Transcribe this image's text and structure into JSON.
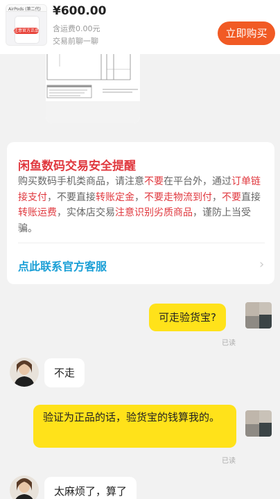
{
  "product": {
    "price": "¥600.00",
    "shipping": "含运费0.00元",
    "negotiate": "交易前聊一聊",
    "buy_label": "立即购买",
    "thumb_topbar": "AirPods (第二代)",
    "thumb_tag": "注意官方正品"
  },
  "notice": {
    "title": "闲鱼数码交易安全提醒",
    "body_parts": [
      {
        "text": "购买数码手机类商品，请注意",
        "red": false
      },
      {
        "text": "不要",
        "red": true
      },
      {
        "text": "在平台外，通过",
        "red": false
      },
      {
        "text": "订单链接支付",
        "red": true
      },
      {
        "text": "，不要直接",
        "red": false
      },
      {
        "text": "转账定金",
        "red": true
      },
      {
        "text": "，",
        "red": false
      },
      {
        "text": "不要走物流到付",
        "red": true
      },
      {
        "text": "，",
        "red": false
      },
      {
        "text": "不要",
        "red": true
      },
      {
        "text": "直接",
        "red": false
      },
      {
        "text": "转账运费",
        "red": true
      },
      {
        "text": "，实体店交易",
        "red": false
      },
      {
        "text": "注意识别劣质商品",
        "red": true
      },
      {
        "text": "，谨防上当受骗。",
        "red": false
      }
    ],
    "link_label": "点此联系官方客服",
    "chevron": "›"
  },
  "messages": [
    {
      "from": "me",
      "text": "可走验货宝?",
      "status": "已读"
    },
    {
      "from": "them",
      "text": "不走"
    },
    {
      "from": "me",
      "text": "验证为正品的话，验货宝的钱算我的。",
      "status": "已读"
    },
    {
      "from": "them",
      "text": "太麻烦了，算了"
    }
  ],
  "colors": {
    "accent": "#f15a24",
    "warning_red": "#e0383e",
    "link_blue": "#1a9fd6",
    "my_bubble": "#ffe21a",
    "background": "#f2f2f2"
  }
}
